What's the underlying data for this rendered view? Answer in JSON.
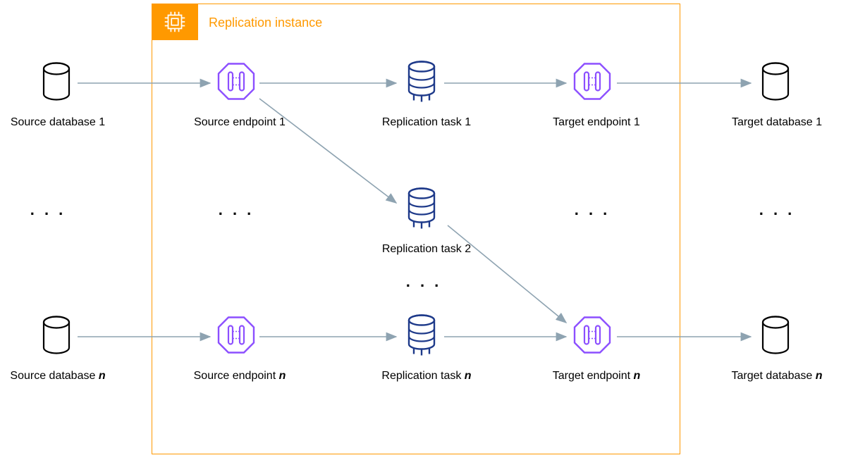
{
  "container": {
    "title": "Replication instance"
  },
  "nodes": {
    "source_db_1": "Source database 1",
    "source_db_n_prefix": "Source database ",
    "source_db_n_italic": "n",
    "source_ep_1": "Source endpoint 1",
    "source_ep_n_prefix": "Source endpoint ",
    "source_ep_n_italic": "n",
    "rep_task_1": "Replication task 1",
    "rep_task_2": "Replication task 2",
    "rep_task_n_prefix": "Replication task ",
    "rep_task_n_italic": "n",
    "target_ep_1": "Target endpoint 1",
    "target_ep_n_prefix": "Target endpoint ",
    "target_ep_n_italic": "n",
    "target_db_1": "Target database 1",
    "target_db_n_prefix": "Target database ",
    "target_db_n_italic": "n"
  },
  "ellipsis": ". . .",
  "colors": {
    "container": "#ff9900",
    "arrow": "#8ea3b1",
    "endpoint": "#8c4fff",
    "task": "#1e3a8a",
    "db": "#000000"
  }
}
